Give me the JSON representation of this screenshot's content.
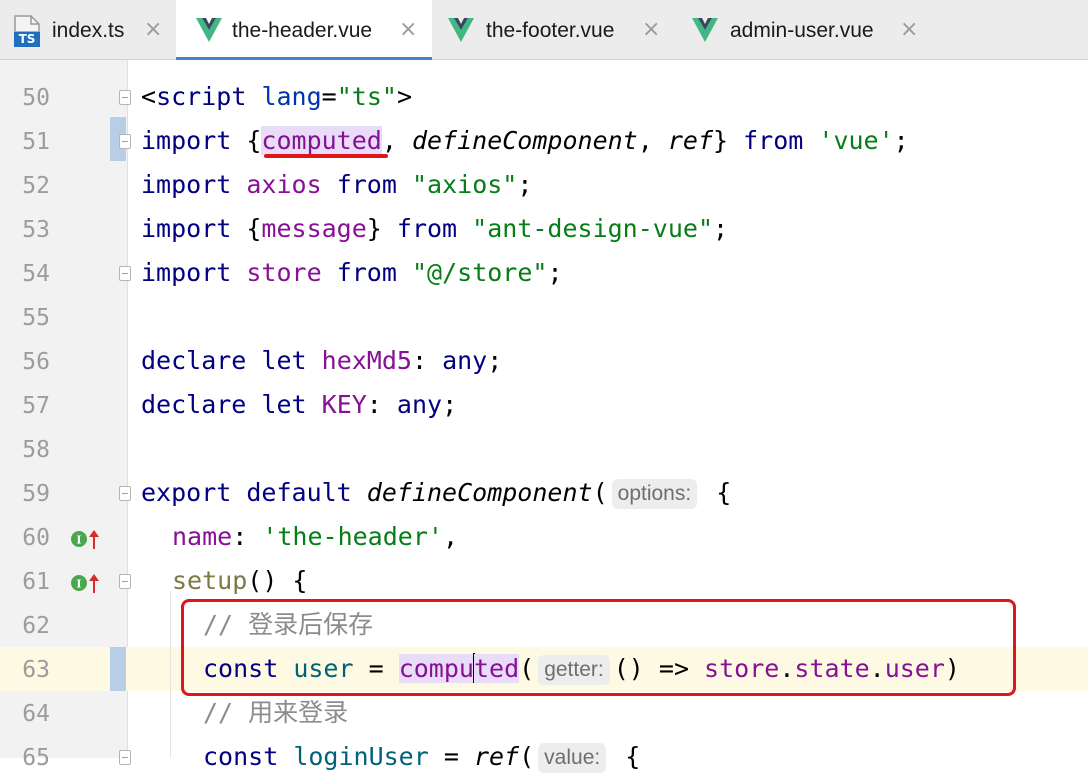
{
  "tabs": [
    {
      "label": "index.ts",
      "icon": "typescript-file-icon",
      "badge": "TS",
      "active": false
    },
    {
      "label": "the-header.vue",
      "icon": "vue-file-icon",
      "active": true
    },
    {
      "label": "the-footer.vue",
      "icon": "vue-file-icon",
      "active": false
    },
    {
      "label": "admin-user.vue",
      "icon": "vue-file-icon",
      "active": false
    }
  ],
  "close_glyph": "×",
  "editor": {
    "line_numbers": [
      "50",
      "51",
      "52",
      "53",
      "54",
      "55",
      "56",
      "57",
      "58",
      "59",
      "60",
      "61",
      "62",
      "63",
      "64",
      "65"
    ],
    "current_line": "63",
    "inlay_hints": {
      "options": "options:",
      "getter": "getter:",
      "value": "value:"
    },
    "lines": {
      "l50": {
        "open": "<",
        "tag": "script",
        "attr": "lang",
        "eq": "=",
        "val": "\"ts\"",
        "close": ">"
      },
      "l51": {
        "kw": "import",
        "lbrace": " {",
        "a": "computed",
        "comma1": ", ",
        "b": "defineComponent",
        "comma2": ", ",
        "c": "ref",
        "rbrace": "} ",
        "from": "from",
        "sp": " ",
        "src": "'vue'",
        "end": ";"
      },
      "l52": {
        "kw": "import",
        "sp1": " ",
        "name": "axios",
        "sp2": " ",
        "from": "from",
        "sp3": " ",
        "src": "\"axios\"",
        "end": ";"
      },
      "l53": {
        "kw": "import",
        "lbrace": " {",
        "name": "message",
        "rbrace": "} ",
        "from": "from",
        "sp": " ",
        "src": "\"ant-design-vue\"",
        "end": ";"
      },
      "l54": {
        "kw": "import",
        "sp1": " ",
        "name": "store",
        "sp2": " ",
        "from": "from",
        "sp3": " ",
        "src": "\"@/store\"",
        "end": ";"
      },
      "l56": {
        "kw1": "declare",
        "sp1": " ",
        "kw2": "let",
        "sp2": " ",
        "name": "hexMd5",
        "colon": ": ",
        "type": "any",
        "end": ";"
      },
      "l57": {
        "kw1": "declare",
        "sp1": " ",
        "kw2": "let",
        "sp2": " ",
        "name": "KEY",
        "colon": ": ",
        "type": "any",
        "end": ";"
      },
      "l59": {
        "kw1": "export",
        "sp1": " ",
        "kw2": "default",
        "sp2": " ",
        "fn": "defineComponent",
        "paren": "(",
        "brace": " {"
      },
      "l60": {
        "key": "name",
        "colon": ": ",
        "val": "'the-header'",
        "end": ","
      },
      "l61": {
        "fn": "setup",
        "rest": "() {"
      },
      "l62": {
        "comment": "// 登录后保存"
      },
      "l63": {
        "kw": "const",
        "sp1": " ",
        "name": "user",
        "eq": " = ",
        "fn_a": "compu",
        "fn_b": "ted",
        "paren": "(",
        "arrow": "() => ",
        "obj": "store",
        "dot1": ".",
        "p1": "state",
        "dot2": ".",
        "p2": "user",
        "close": ")"
      },
      "l64": {
        "comment": "// 用来登录"
      },
      "l65": {
        "kw": "const",
        "sp1": " ",
        "name": "loginUser",
        "eq": " = ",
        "fn": "ref",
        "paren": "(",
        "brace": " {"
      }
    }
  },
  "colors": {
    "keyword": "#000080",
    "string": "#067d17",
    "comment": "#8c8c8c",
    "purple": "#871094",
    "highlight_box": "#e0151b",
    "active_tab_underline": "#4083c9"
  }
}
